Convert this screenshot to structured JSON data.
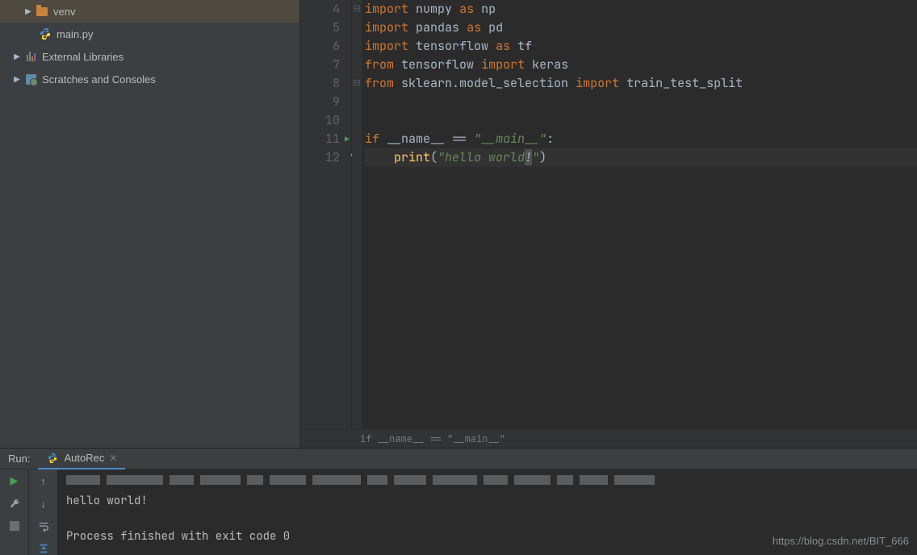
{
  "sidebar": {
    "items": [
      {
        "label": "venv",
        "type": "folder"
      },
      {
        "label": "main.py",
        "type": "python"
      },
      {
        "label": "External Libraries",
        "type": "libs"
      },
      {
        "label": "Scratches and Consoles",
        "type": "scratch"
      }
    ]
  },
  "editor": {
    "lines": [
      4,
      5,
      6,
      7,
      8,
      9,
      10,
      11,
      12
    ],
    "code": {
      "l4": {
        "kw": "import",
        "id": "numpy",
        "as": "as",
        "alias": "np"
      },
      "l5": {
        "kw": "import",
        "id": "pandas",
        "as": "as",
        "alias": "pd"
      },
      "l6": {
        "kw": "import",
        "id": "tensorflow",
        "as": "as",
        "alias": "tf"
      },
      "l7": {
        "kw": "from",
        "id": "tensorflow",
        "imp": "import",
        "what": "keras"
      },
      "l8": {
        "kw": "from",
        "id": "sklearn.model_selection",
        "imp": "import",
        "what": "train_test_split"
      },
      "l11": {
        "if": "if",
        "name": "__name__",
        "eq": "==",
        "main": "\"__main__\"",
        "colon": ":"
      },
      "l12": {
        "fn": "print",
        "open": "(",
        "str1": "\"hello world",
        "curs": "!",
        "str2": "\"",
        "close": ")"
      }
    },
    "breadcrumb": "if __name__ == \"__main__\""
  },
  "run": {
    "label": "Run:",
    "tab": "AutoRec",
    "out1": "hello world!",
    "out2": "Process finished with exit code 0"
  },
  "watermark": "https://blog.csdn.net/BIT_666"
}
